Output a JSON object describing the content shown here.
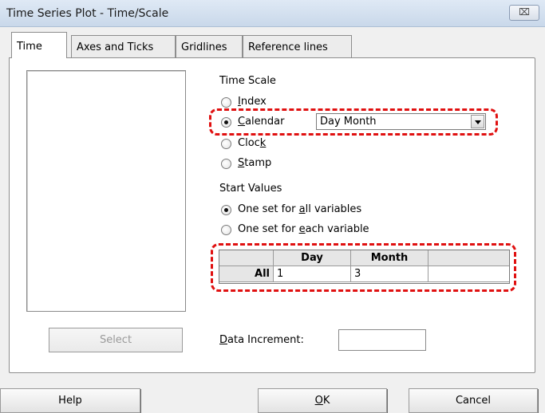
{
  "window": {
    "title": "Time Series Plot - Time/Scale",
    "close_symbol": "⌧"
  },
  "tabs": [
    {
      "label": "Time",
      "active": true
    },
    {
      "label": "Axes and Ticks",
      "active": false
    },
    {
      "label": "Gridlines",
      "active": false
    },
    {
      "label": "Reference lines",
      "active": false
    }
  ],
  "select_button": {
    "label": "Select",
    "enabled": false
  },
  "time_scale": {
    "heading": "Time Scale",
    "options": [
      {
        "pre": "",
        "key": "I",
        "post": "ndex",
        "selected": false
      },
      {
        "pre": "",
        "key": "C",
        "post": "alendar",
        "selected": true
      },
      {
        "pre": "Cloc",
        "key": "k",
        "post": "",
        "selected": false
      },
      {
        "pre": "",
        "key": "S",
        "post": "tamp",
        "selected": false
      }
    ],
    "calendar_format": "Day Month"
  },
  "start_values": {
    "heading": "Start Values",
    "options": [
      {
        "pre": "One set for ",
        "key": "a",
        "post": "ll variables",
        "selected": true
      },
      {
        "pre": "One set for ",
        "key": "e",
        "post": "ach variable",
        "selected": false
      }
    ],
    "table": {
      "columns": [
        "Day",
        "Month"
      ],
      "row_label": "All",
      "values": [
        "1",
        "3"
      ]
    }
  },
  "data_increment": {
    "pre": "",
    "key": "D",
    "post": "ata Increment:",
    "value": ""
  },
  "buttons": {
    "help": "Help",
    "ok": {
      "pre": "",
      "key": "O",
      "post": "K"
    },
    "cancel": "Cancel"
  },
  "colors": {
    "highlight": "#e01010"
  }
}
